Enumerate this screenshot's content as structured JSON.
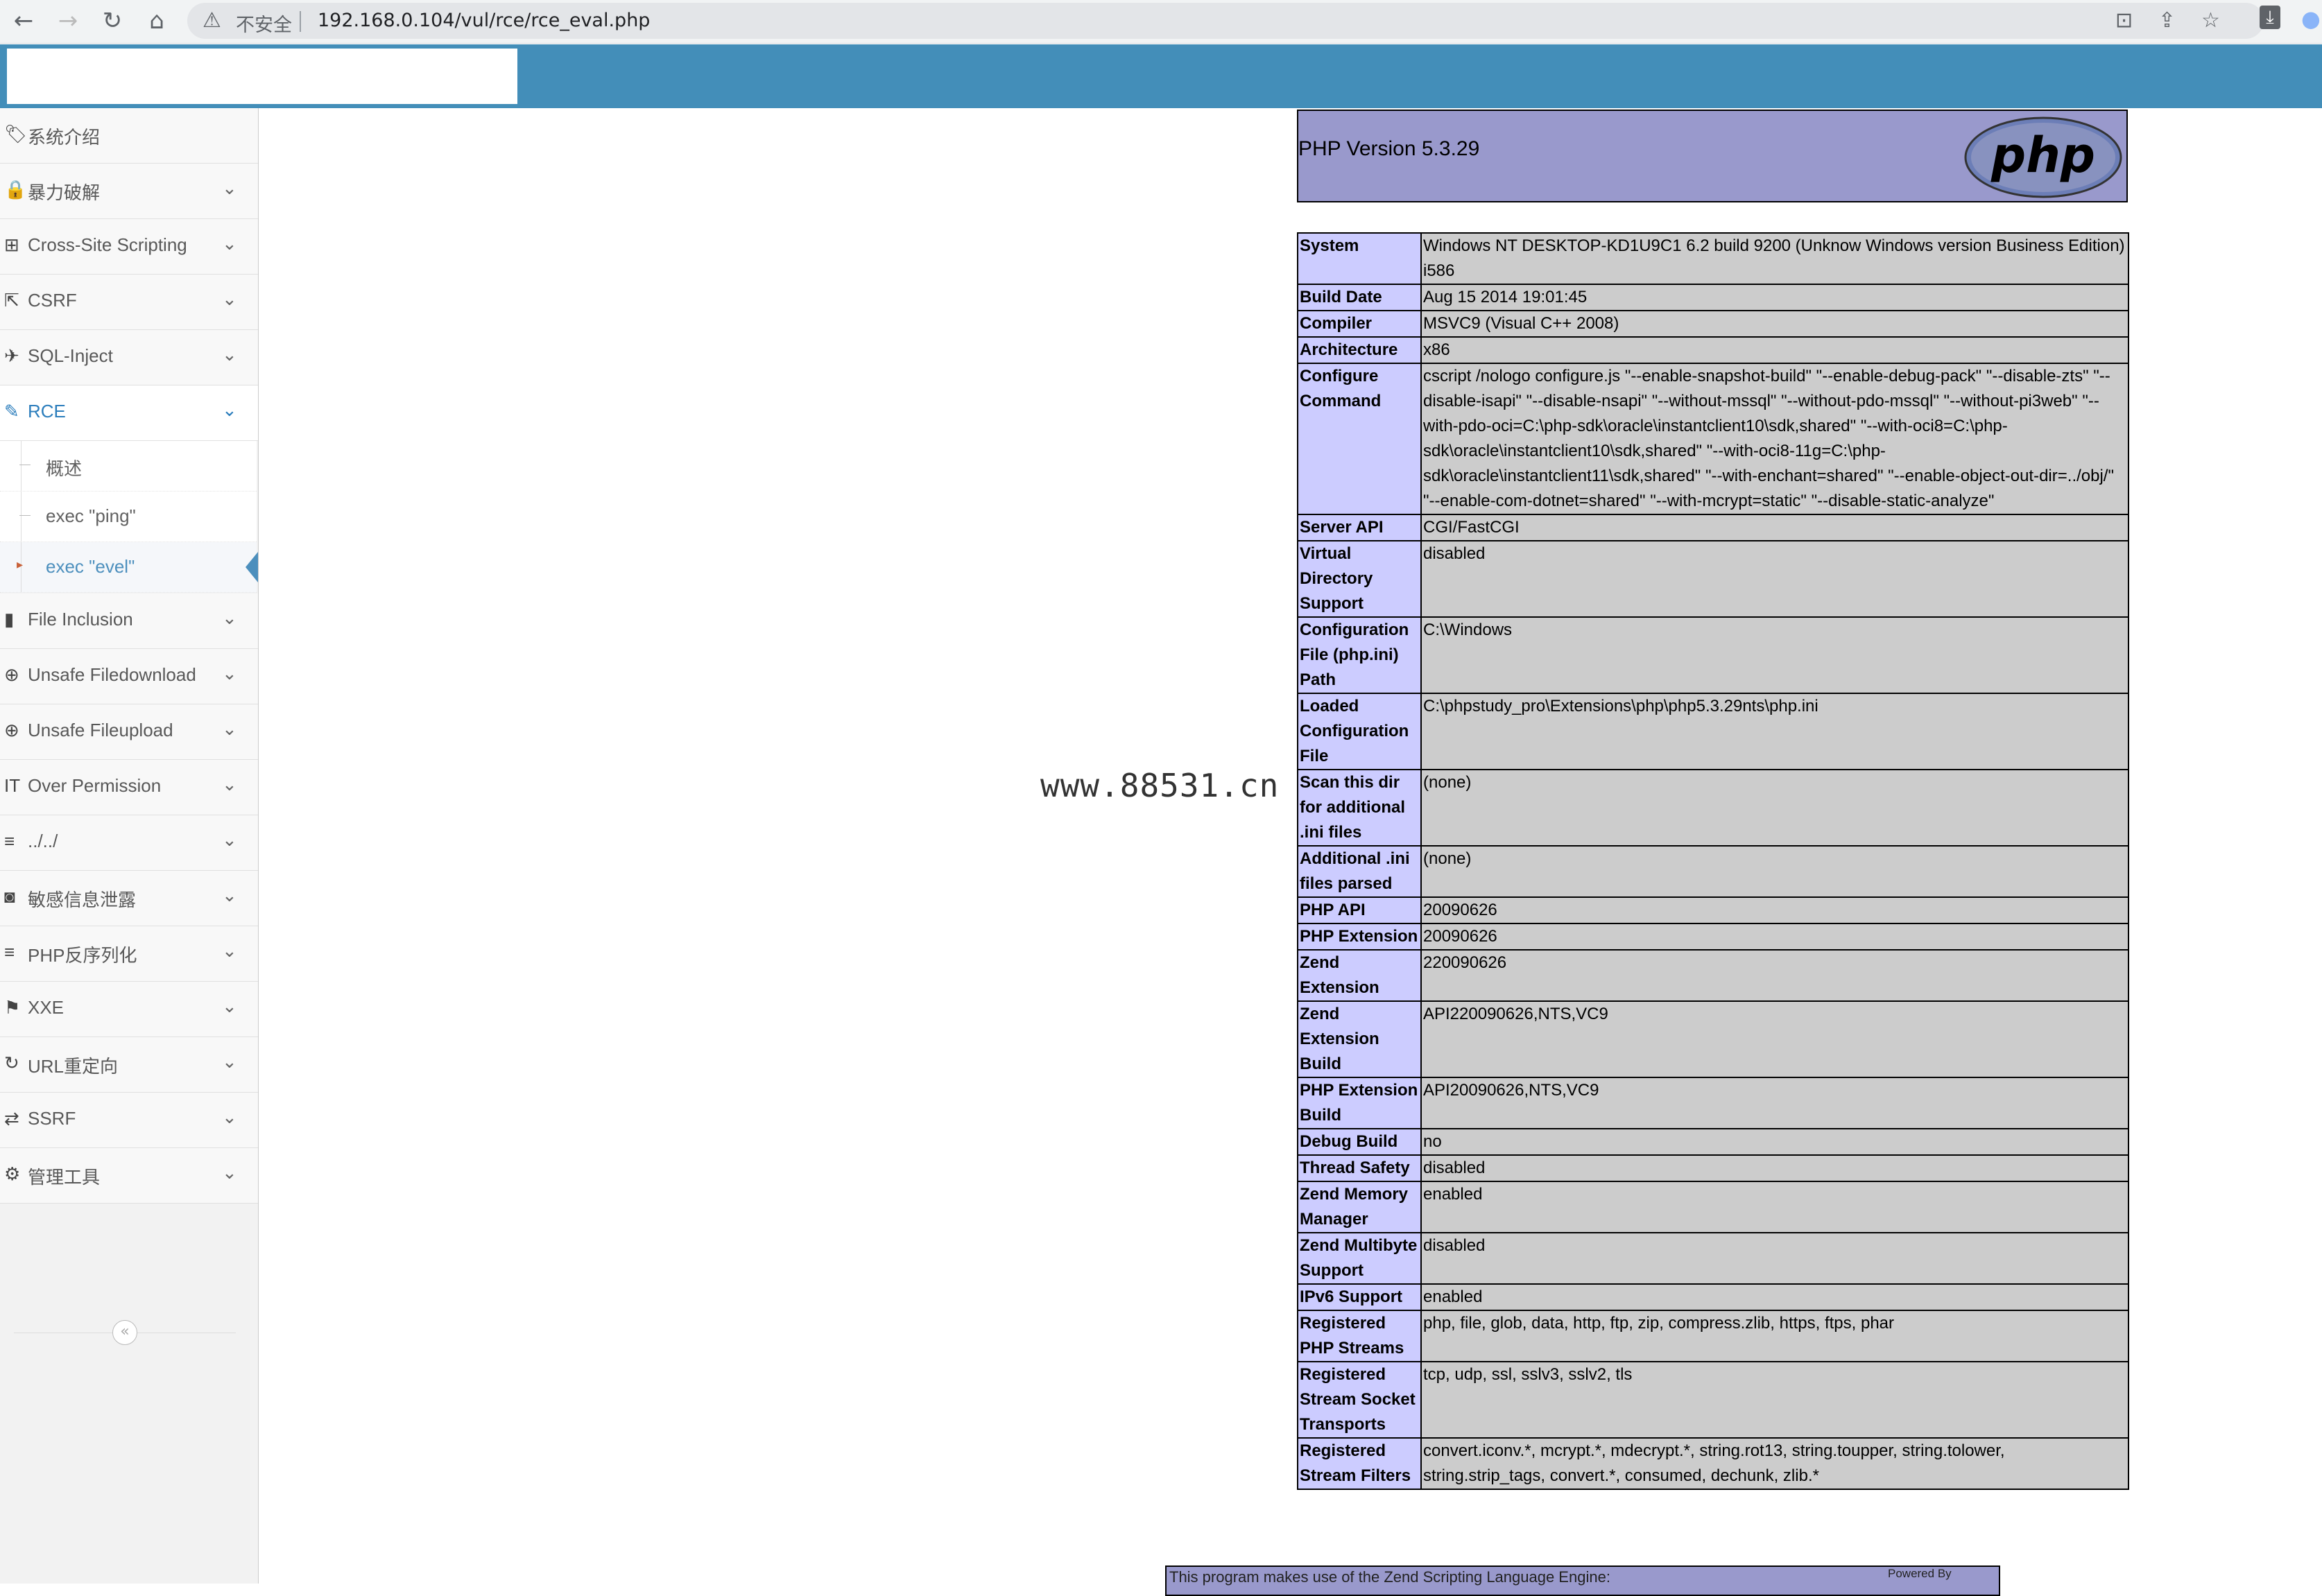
{
  "browser": {
    "url": "192.168.0.104/vul/rce/rce_eval.php",
    "security_label": "不安全",
    "back_icon": "←",
    "forward_icon": "→",
    "reload_icon": "↻",
    "home_icon": "⌂"
  },
  "sidebar": {
    "items": [
      {
        "label": "系统介绍",
        "icon": "tag-icon",
        "glyph": "🏷"
      },
      {
        "label": "暴力破解",
        "icon": "lock-icon",
        "glyph": "🔒"
      },
      {
        "label": "Cross-Site Scripting",
        "icon": "list-tree-icon",
        "glyph": "⊞"
      },
      {
        "label": "CSRF",
        "icon": "share-icon",
        "glyph": "⇱"
      },
      {
        "label": "SQL-Inject",
        "icon": "plane-icon",
        "glyph": "✈"
      },
      {
        "label": "RCE",
        "icon": "pencil-icon",
        "glyph": "✎"
      }
    ],
    "rce_sub": [
      {
        "label": "概述"
      },
      {
        "label": "exec \"ping\""
      },
      {
        "label": "exec \"evel\""
      }
    ],
    "items_after": [
      {
        "label": "File Inclusion",
        "icon": "file-icon",
        "glyph": "▮"
      },
      {
        "label": "Unsafe Filedownload",
        "icon": "download-circle-icon",
        "glyph": "⊕"
      },
      {
        "label": "Unsafe Fileupload",
        "icon": "upload-circle-icon",
        "glyph": "⊕"
      },
      {
        "label": "Over Permission",
        "icon": "text-icon",
        "glyph": "IT"
      },
      {
        "label": "../../",
        "icon": "align-left-icon",
        "glyph": "≡"
      },
      {
        "label": "敏感信息泄露",
        "icon": "camera-icon",
        "glyph": "◙"
      },
      {
        "label": "PHP反序列化",
        "icon": "align-icon",
        "glyph": "≡"
      },
      {
        "label": "XXE",
        "icon": "flag-icon",
        "glyph": "⚑"
      },
      {
        "label": "URL重定向",
        "icon": "refresh-icon",
        "glyph": "↻"
      },
      {
        "label": "SSRF",
        "icon": "exchange-icon",
        "glyph": "⇄"
      },
      {
        "label": "管理工具",
        "icon": "gear-icon",
        "glyph": "⚙"
      }
    ],
    "collapse_glyph": "«"
  },
  "watermark": "www.88531.cn",
  "php": {
    "title": "PHP Version 5.3.29",
    "logo_text": "php",
    "rows": [
      [
        "System",
        "Windows NT DESKTOP-KD1U9C1 6.2 build 9200 (Unknow Windows version Business Edition) i586"
      ],
      [
        "Build Date",
        "Aug 15 2014 19:01:45"
      ],
      [
        "Compiler",
        "MSVC9 (Visual C++ 2008)"
      ],
      [
        "Architecture",
        "x86"
      ],
      [
        "Configure Command",
        "cscript /nologo configure.js \"--enable-snapshot-build\" \"--enable-debug-pack\" \"--disable-zts\" \"--disable-isapi\" \"--disable-nsapi\" \"--without-mssql\" \"--without-pdo-mssql\" \"--without-pi3web\" \"--with-pdo-oci=C:\\php-sdk\\oracle\\instantclient10\\sdk,shared\" \"--with-oci8=C:\\php-sdk\\oracle\\instantclient10\\sdk,shared\" \"--with-oci8-11g=C:\\php-sdk\\oracle\\instantclient11\\sdk,shared\" \"--with-enchant=shared\" \"--enable-object-out-dir=../obj/\" \"--enable-com-dotnet=shared\" \"--with-mcrypt=static\" \"--disable-static-analyze\""
      ],
      [
        "Server API",
        "CGI/FastCGI"
      ],
      [
        "Virtual Directory Support",
        "disabled"
      ],
      [
        "Configuration File (php.ini) Path",
        "C:\\Windows"
      ],
      [
        "Loaded Configuration File",
        "C:\\phpstudy_pro\\Extensions\\php\\php5.3.29nts\\php.ini"
      ],
      [
        "Scan this dir for additional .ini files",
        "(none)"
      ],
      [
        "Additional .ini files parsed",
        "(none)"
      ],
      [
        "PHP API",
        "20090626"
      ],
      [
        "PHP Extension",
        "20090626"
      ],
      [
        "Zend Extension",
        "220090626"
      ],
      [
        "Zend Extension Build",
        "API220090626,NTS,VC9"
      ],
      [
        "PHP Extension Build",
        "API20090626,NTS,VC9"
      ],
      [
        "Debug Build",
        "no"
      ],
      [
        "Thread Safety",
        "disabled"
      ],
      [
        "Zend Memory Manager",
        "enabled"
      ],
      [
        "Zend Multibyte Support",
        "disabled"
      ],
      [
        "IPv6 Support",
        "enabled"
      ],
      [
        "Registered PHP Streams",
        "php, file, glob, data, http, ftp, zip, compress.zlib, https, ftps, phar"
      ],
      [
        "Registered Stream Socket Transports",
        "tcp, udp, ssl, sslv3, sslv2, tls"
      ],
      [
        "Registered Stream Filters",
        "convert.iconv.*, mcrypt.*, mdecrypt.*, string.rot13, string.toupper, string.tolower, string.strip_tags, convert.*, consumed, dechunk, zlib.*"
      ]
    ],
    "footer_text": "This program makes use of the Zend Scripting Language Engine:",
    "powered_by": "Powered By"
  }
}
